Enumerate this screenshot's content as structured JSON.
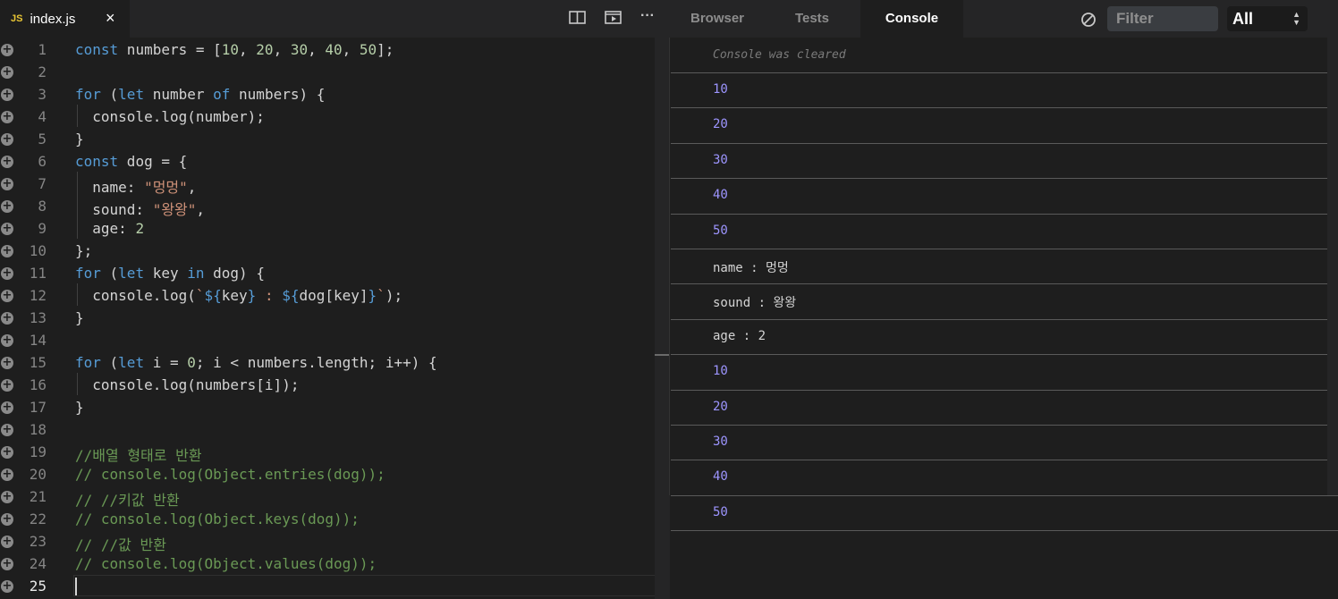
{
  "file_tab": {
    "badge": "JS",
    "name": "index.js",
    "close": "×"
  },
  "toolbar": {
    "icons": [
      "split-view-icon",
      "preview-icon",
      "more-icon"
    ],
    "more_glyph": "···"
  },
  "panel_tabs": [
    {
      "label": "Browser",
      "active": false
    },
    {
      "label": "Tests",
      "active": false
    },
    {
      "label": "Console",
      "active": true
    }
  ],
  "console_toolbar": {
    "filter_placeholder": "Filter",
    "level_value": "All"
  },
  "editor": {
    "current_line": 25,
    "lines": [
      {
        "num": "1",
        "html": "<span class='k'>const</span> numbers = [<span class='n'>10</span>, <span class='n'>20</span>, <span class='n'>30</span>, <span class='n'>40</span>, <span class='n'>50</span>];"
      },
      {
        "num": "2",
        "html": ""
      },
      {
        "num": "3",
        "html": "<span class='k'>for</span> (<span class='k'>let</span> number <span class='k'>of</span> numbers) {"
      },
      {
        "num": "4",
        "html": "  console.log(number);"
      },
      {
        "num": "5",
        "html": "}"
      },
      {
        "num": "6",
        "html": "<span class='k'>const</span> dog = {"
      },
      {
        "num": "7",
        "html": "  name: <span class='s'>\"멍멍\"</span>,"
      },
      {
        "num": "8",
        "html": "  sound: <span class='s'>\"왕왕\"</span>,"
      },
      {
        "num": "9",
        "html": "  age: <span class='n'>2</span>"
      },
      {
        "num": "10",
        "html": "};"
      },
      {
        "num": "11",
        "html": "<span class='k'>for</span> (<span class='k'>let</span> key <span class='k'>in</span> dog) {"
      },
      {
        "num": "12",
        "html": "  console.log(<span class='s'>`</span><span class='k'>${</span>key<span class='k'>}</span><span class='s'> : </span><span class='k'>${</span>dog[key]<span class='k'>}</span><span class='s'>`</span>);"
      },
      {
        "num": "13",
        "html": "}"
      },
      {
        "num": "14",
        "html": ""
      },
      {
        "num": "15",
        "html": "<span class='k'>for</span> (<span class='k'>let</span> i = <span class='n'>0</span>; i &lt; numbers.length; i++) {"
      },
      {
        "num": "16",
        "html": "  console.log(numbers[i]);"
      },
      {
        "num": "17",
        "html": "}"
      },
      {
        "num": "18",
        "html": ""
      },
      {
        "num": "19",
        "html": "<span class='c'>//배열 형태로 반환</span>"
      },
      {
        "num": "20",
        "html": "<span class='c'>// console.log(Object.entries(dog));</span>"
      },
      {
        "num": "21",
        "html": "<span class='c'>// //키값 반환</span>"
      },
      {
        "num": "22",
        "html": "<span class='c'>// console.log(Object.keys(dog));</span>"
      },
      {
        "num": "23",
        "html": "<span class='c'>// //값 반환</span>"
      },
      {
        "num": "24",
        "html": "<span class='c'>// console.log(Object.values(dog));</span>"
      },
      {
        "num": "25",
        "html": ""
      }
    ]
  },
  "console": {
    "cleared_message": "Console was cleared",
    "entries": [
      {
        "text": "10",
        "type": "num"
      },
      {
        "text": "20",
        "type": "num"
      },
      {
        "text": "30",
        "type": "num"
      },
      {
        "text": "40",
        "type": "num"
      },
      {
        "text": "50",
        "type": "num"
      },
      {
        "text": "name : 멍멍",
        "type": "str"
      },
      {
        "text": "sound : 왕왕",
        "type": "str"
      },
      {
        "text": "age : 2",
        "type": "str"
      },
      {
        "text": "10",
        "type": "num"
      },
      {
        "text": "20",
        "type": "num"
      },
      {
        "text": "30",
        "type": "num"
      },
      {
        "text": "40",
        "type": "num"
      },
      {
        "text": "50",
        "type": "num"
      }
    ]
  }
}
